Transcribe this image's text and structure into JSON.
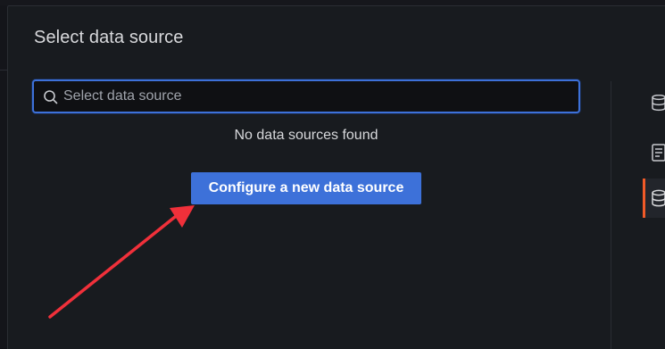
{
  "modal": {
    "title": "Select data source"
  },
  "search": {
    "placeholder": "Select data source",
    "value": ""
  },
  "empty_state": {
    "message": "No data sources found",
    "cta_label": "Configure a new data source"
  },
  "side_tabs": [
    {
      "icon": "database-stack-icon",
      "active": false
    },
    {
      "icon": "dashboard-icon",
      "active": false
    },
    {
      "icon": "database-icon",
      "active": true
    }
  ],
  "colors": {
    "accent": "#3d71d9",
    "active_tab_marker": "#f05a28",
    "annotation_arrow": "#f0303a"
  }
}
